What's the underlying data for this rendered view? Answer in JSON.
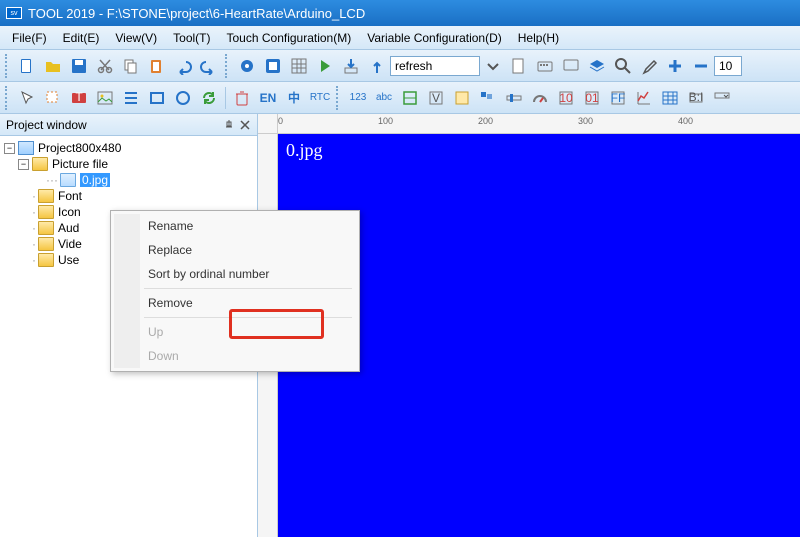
{
  "titlebar": {
    "app": "TOOL 2019",
    "path": "F:\\STONE\\project\\6-HeartRate\\Arduino_LCD"
  },
  "menu": {
    "file": "File(F)",
    "edit": "Edit(E)",
    "view": "View(V)",
    "tool": "Tool(T)",
    "touch": "Touch Configuration(M)",
    "variable": "Variable Configuration(D)",
    "help": "Help(H)"
  },
  "toolbar": {
    "combo_value": "refresh",
    "spin_value": "10",
    "text_en": "EN",
    "text_zh": "中",
    "text_rtc": "RTC",
    "text_123": "123",
    "text_abc": "abc"
  },
  "project_panel": {
    "title": "Project window"
  },
  "tree": {
    "root": "Project800x480",
    "picture": "Picture file",
    "image": "0.jpg",
    "font": "Font",
    "icon": "Icon",
    "audio": "Aud",
    "video": "Vide",
    "user": "Use"
  },
  "canvas": {
    "label": "0.jpg"
  },
  "ruler": {
    "t0": "0",
    "t100": "100",
    "t200": "200",
    "t300": "300",
    "t400": "400"
  },
  "context": {
    "rename": "Rename",
    "replace": "Replace",
    "sort": "Sort by ordinal number",
    "remove": "Remove",
    "up": "Up",
    "down": "Down"
  }
}
